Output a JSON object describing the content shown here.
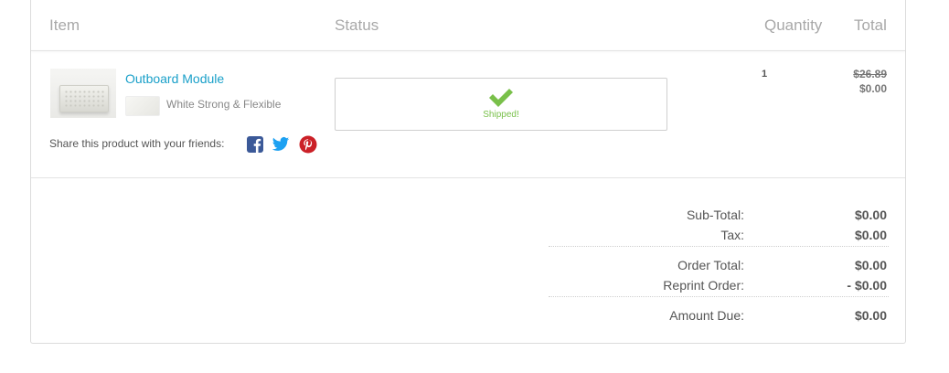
{
  "table": {
    "headers": {
      "item": "Item",
      "status": "Status",
      "quantity": "Quantity",
      "total": "Total"
    }
  },
  "product": {
    "name": "Outboard Module",
    "material": "White Strong & Flexible",
    "share_label": "Share this product with your friends:",
    "status_text": "Shipped!",
    "quantity": "1",
    "original_price": "$26.89",
    "price": "$0.00"
  },
  "social_icons": [
    "facebook-icon",
    "twitter-icon",
    "pinterest-icon"
  ],
  "summary": [
    {
      "label": "Sub-Total:",
      "value": "$0.00"
    },
    {
      "label": "Tax:",
      "value": "$0.00"
    },
    {
      "label": "Order Total:",
      "value": "$0.00"
    },
    {
      "label": "Reprint Order:",
      "value": "- $0.00"
    },
    {
      "label": "Amount Due:",
      "value": "$0.00"
    }
  ],
  "colors": {
    "link": "#1aa0c9",
    "shipped": "#79c04a",
    "facebook": "#3b5998",
    "twitter": "#1da1f2",
    "pinterest": "#cb2027"
  }
}
